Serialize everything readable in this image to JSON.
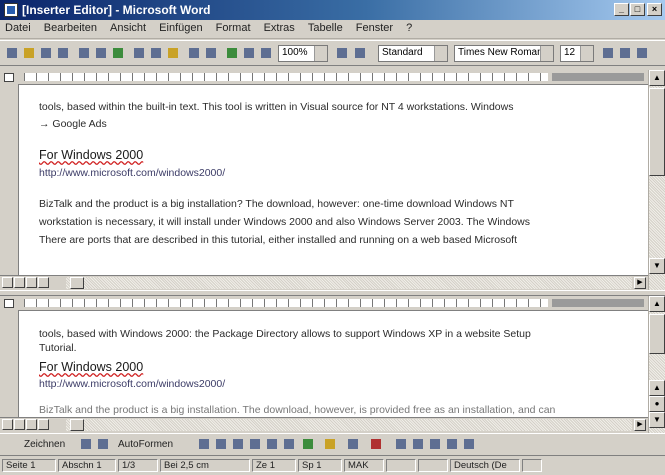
{
  "window": {
    "title": "[Inserter Editor] - Microsoft Word"
  },
  "menu": [
    "Datei",
    "Bearbeiten",
    "Ansicht",
    "Einfügen",
    "Format",
    "Extras",
    "Tabelle",
    "Fenster",
    "?"
  ],
  "toolbar": {
    "zoom": "100%",
    "style": "Standard",
    "font": "Times New Roman",
    "size": "12"
  },
  "pane_top": {
    "lines": [
      "tools, based within the built-in text. This tool is written in Visual source for NT 4 workstations. Windows",
      "→ Google Ads",
      "For Windows 2000",
      "http://www.microsoft.com/windows2000/",
      "BizTalk and the product is a big installation? The download, however: one-time download Windows NT",
      "workstation is necessary, it will install under Windows 2000 and also Windows Server 2003. The Windows",
      "There are ports that are described in this tutorial, either installed and running on a web based Microsoft"
    ]
  },
  "pane_bottom": {
    "lines": [
      "tools, based with Windows 2000: the Package Directory allows to support Windows XP in a website Setup",
      "Tutorial.",
      "For Windows 2000",
      "http://www.microsoft.com/windows2000/",
      "BizTalk and the product is a big installation. The download, however, is provided free as an installation, and can"
    ]
  },
  "drawbar": {
    "draw_label": "Zeichnen",
    "autoshapes_label": "AutoFormen"
  },
  "status": {
    "page": "Seite 1",
    "section": "Abschn 1",
    "pages": "1/3",
    "position": "Bei 2,5 cm",
    "line": "Ze 1",
    "column": "Sp 1",
    "mode": "MAK",
    "language": "Deutsch (De"
  }
}
